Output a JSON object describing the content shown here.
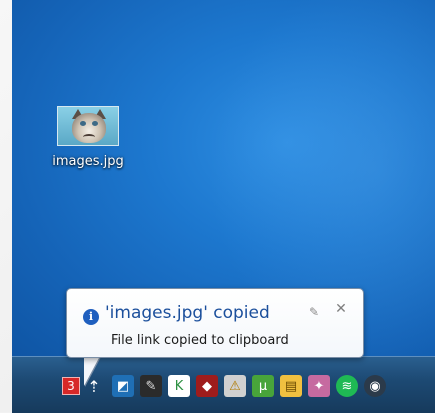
{
  "desktop": {
    "icon": {
      "label": "images.jpg"
    }
  },
  "notification": {
    "title": "'images.jpg' copied",
    "message": "File link copied to clipboard",
    "settings_icon": "wrench-icon",
    "close_icon": "close-icon",
    "info_icon": "info-icon"
  },
  "taskbar": {
    "badge_count": "3",
    "tray_icons": [
      "tray-app-blue-icon",
      "tray-app-white-icon",
      "tray-kaspersky-icon",
      "tray-red-diamond-icon",
      "tray-warning-icon",
      "tray-utorrent-icon",
      "tray-yellow-folder-icon",
      "tray-pink-icon",
      "tray-spotify-icon",
      "tray-steam-icon"
    ]
  },
  "colors": {
    "desktop_blue": "#1d78cf",
    "taskbar": "#1d4a74",
    "badge_red": "#d72828",
    "balloon_title": "#1b4f9c",
    "info_blue": "#1f5fbf"
  }
}
